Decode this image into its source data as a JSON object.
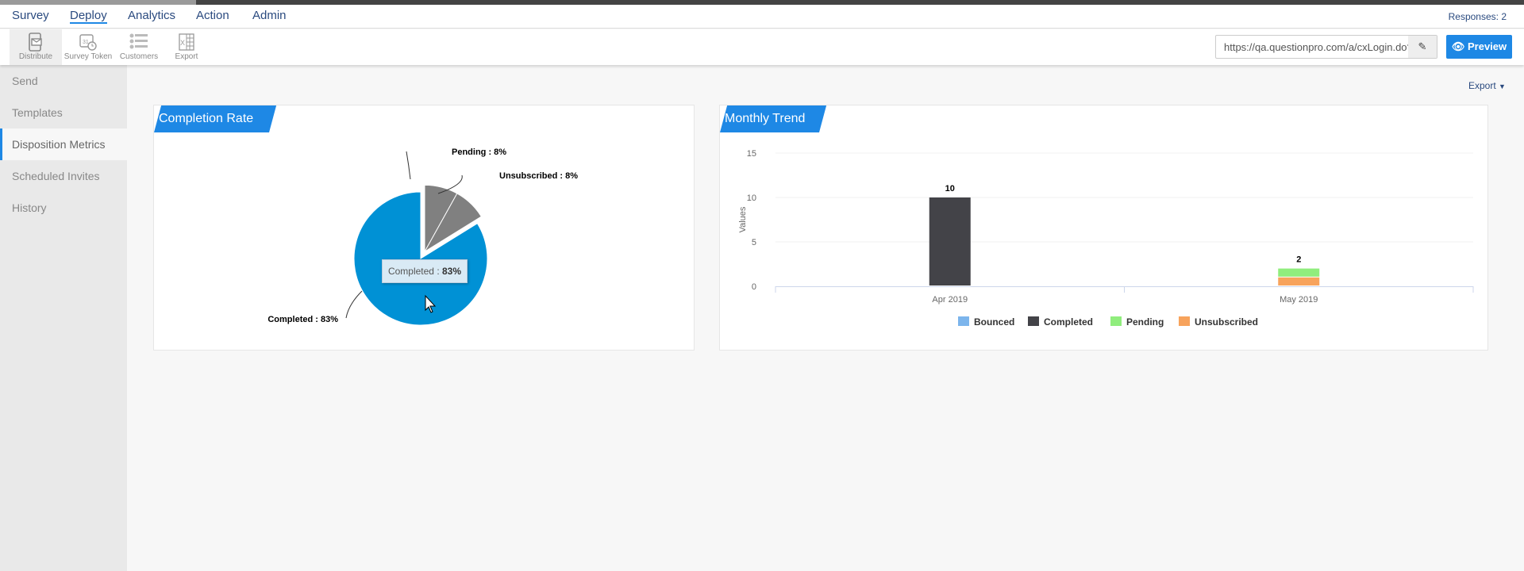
{
  "nav": {
    "items": [
      "Survey",
      "Deploy",
      "Analytics",
      "Action",
      "Admin"
    ],
    "active": "Deploy",
    "responses": "Responses: 2"
  },
  "toolbar": {
    "tools": [
      {
        "label": "Distribute",
        "icon": "mobile-mail-icon"
      },
      {
        "label": "Survey Token",
        "icon": "calendar-clock-icon"
      },
      {
        "label": "Customers",
        "icon": "user-list-icon"
      },
      {
        "label": "Export",
        "icon": "excel-icon"
      }
    ],
    "url_value": "https://qa.questionpro.com/a/cxLogin.do?i",
    "edit_icon": "pencil-icon",
    "preview_label": "Preview",
    "preview_icon": "eye-icon"
  },
  "sidebar": {
    "items": [
      "Send",
      "Templates",
      "Disposition Metrics",
      "Scheduled Invites",
      "History"
    ],
    "active": "Disposition Metrics"
  },
  "export_label": "Export",
  "colors": {
    "accent": "#1e88e5",
    "completed_pie": "#0091d5",
    "other_pie": "#808080",
    "bounced": "#7cb5ec",
    "completed": "#434348",
    "pending": "#90ed7d",
    "unsubscribed": "#f7a35c"
  },
  "chart_data": [
    {
      "type": "pie",
      "title": "Completion Rate",
      "slices": [
        {
          "name": "Pending",
          "value": 8,
          "label": "Pending : 8%"
        },
        {
          "name": "Unsubscribed",
          "value": 8,
          "label": "Unsubscribed : 8%"
        },
        {
          "name": "Completed",
          "value": 83,
          "label": "Completed : 83%"
        }
      ],
      "tooltip": {
        "name": "Completed : ",
        "value": "83%"
      }
    },
    {
      "type": "bar",
      "stacked": true,
      "title": "Monthly Trend",
      "ylabel": "Values",
      "ylim": [
        0,
        15
      ],
      "yticks": [
        0,
        5,
        10,
        15
      ],
      "categories": [
        "Apr 2019",
        "May 2019"
      ],
      "series": [
        {
          "name": "Bounced",
          "values": [
            0,
            0
          ]
        },
        {
          "name": "Completed",
          "values": [
            10,
            0
          ]
        },
        {
          "name": "Pending",
          "values": [
            0,
            1
          ]
        },
        {
          "name": "Unsubscribed",
          "values": [
            0,
            1
          ]
        }
      ],
      "totals": [
        10,
        2
      ],
      "legend": "bottom"
    }
  ]
}
